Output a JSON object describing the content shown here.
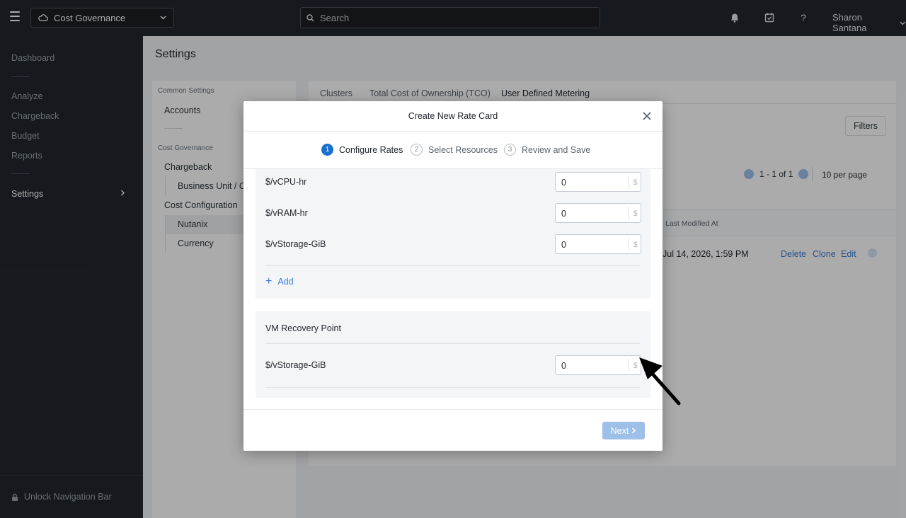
{
  "topbar": {
    "app_selector": "Cost Governance",
    "search_placeholder": "Search",
    "user_name": "Sharon Santana",
    "icons": [
      "menu-icon",
      "cloud-icon",
      "chevron-down-icon",
      "search-icon",
      "bell-icon",
      "tasks-icon",
      "help-icon"
    ]
  },
  "leftnav": {
    "items": [
      "Dashboard",
      "Analyze",
      "Chargeback",
      "Budget",
      "Reports",
      "Settings"
    ],
    "active": "Settings",
    "unlock_label": "Unlock Navigation Bar"
  },
  "page": {
    "title": "Settings"
  },
  "settings_menu": {
    "common_heading": "Common Settings",
    "accounts": "Accounts",
    "cost_governance_heading": "Cost Governance",
    "chargeback": "Chargeback",
    "business_unit": "Business Unit / Co",
    "cost_configuration": "Cost Configuration",
    "nutanix": "Nutanix",
    "currency": "Currency"
  },
  "main": {
    "tabs": [
      "Clusters",
      "Total Cost of Ownership (TCO)",
      "User Defined Metering"
    ],
    "active_tab": "User Defined Metering",
    "filters": "Filters",
    "pager": "1 - 1 of 1",
    "per_page": "10 per page",
    "column_last_modified": "Last Modified At",
    "row": {
      "last_modified": "Jul 14, 2026, 1:59 PM",
      "actions": [
        "Delete",
        "Clone",
        "Edit"
      ]
    }
  },
  "modal": {
    "title": "Create New Rate Card",
    "steps": [
      {
        "num": "1",
        "label": "Configure Rates",
        "active": true
      },
      {
        "num": "2",
        "label": "Select Resources",
        "active": false
      },
      {
        "num": "3",
        "label": "Review and Save",
        "active": false
      }
    ],
    "vm_rates": [
      {
        "label": "$/vCPU-hr",
        "value": "0",
        "currency": "$"
      },
      {
        "label": "$/vRAM-hr",
        "value": "0",
        "currency": "$"
      },
      {
        "label": "$/vStorage-GiB",
        "value": "0",
        "currency": "$"
      }
    ],
    "add_label": "Add",
    "recovery_section_title": "VM Recovery Point",
    "recovery_rates": [
      {
        "label": "$/vStorage-GiB",
        "value": "0",
        "currency": "$"
      }
    ],
    "next_label": "Next"
  }
}
